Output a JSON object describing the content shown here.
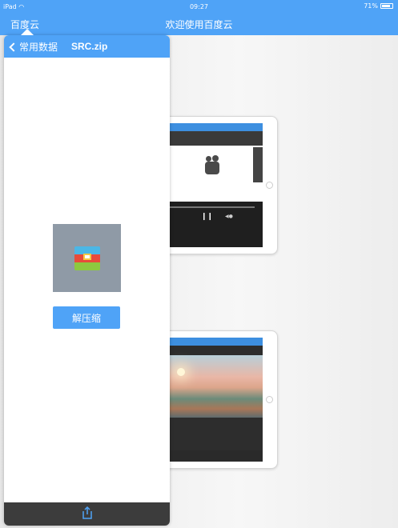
{
  "status_bar": {
    "device": "iPad",
    "time": "09:27",
    "battery": "71%"
  },
  "nav": {
    "app_title": "百度云",
    "page_title": "欢迎使用百度云"
  },
  "sidebar": {
    "back_label": "常用数据",
    "file_name": "SRC.zip",
    "unzip_label": "解压缩"
  },
  "colors": {
    "accent": "#4fa3f7",
    "footer": "#3c3c3c",
    "zip_bg": "#8f9aa6",
    "zip_bands": [
      "#4bb7e6",
      "#e84b3a",
      "#8dc83f"
    ]
  },
  "icons": {
    "back": "chevron-left-icon",
    "file": "zip-file-icon",
    "share": "share-icon",
    "wifi": "wifi-icon",
    "battery": "battery-icon"
  }
}
